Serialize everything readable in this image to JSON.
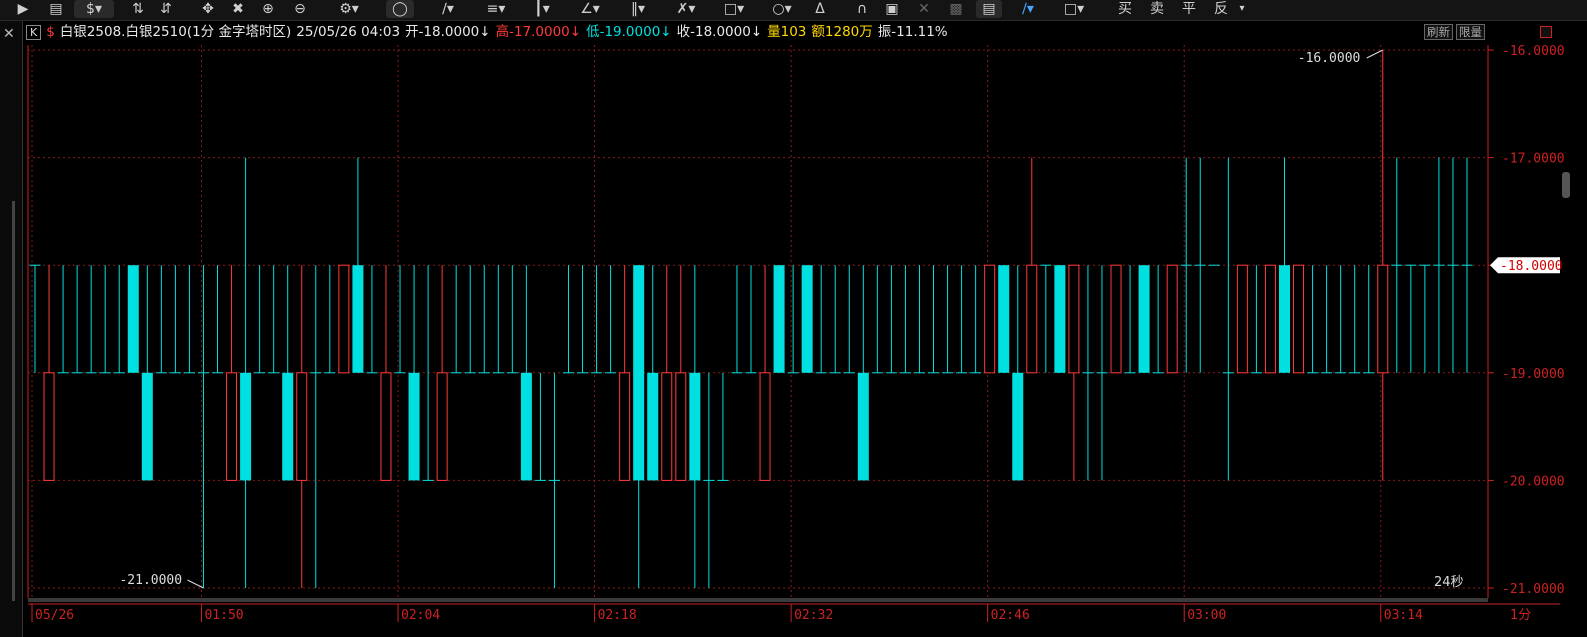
{
  "toolbar": {
    "trade_labels": [
      "买",
      "卖",
      "平",
      "反"
    ]
  },
  "info": {
    "k_label": "K",
    "dollar": "$",
    "title": "白银2508.白银2510(1分 金字塔时区)",
    "datetime": "25/05/26 04:03",
    "open": "开-18.0000",
    "high": "高-17.0000",
    "low": "低-19.0000",
    "close": "收-18.0000",
    "volume": "量103",
    "amount": "额1280万",
    "amplitude": "振-11.11%",
    "refresh": "刷新",
    "limit": "限量"
  },
  "colors": {
    "up": "#ff3b3b",
    "down": "#00e0e0",
    "grid": "#8a1a1a",
    "axis": "#cc2222",
    "text": "#dddddd",
    "yellow": "#ffd800"
  },
  "chart_data": {
    "type": "candlestick",
    "y_ticks": [
      "-16.0000",
      "-17.0000",
      "-18.0000",
      "-19.0000",
      "-20.0000",
      "-21.0000"
    ],
    "y_range": [
      -21,
      -16
    ],
    "current_price": "-18.0000",
    "x_ticks": [
      "05/26",
      "01:50",
      "02:04",
      "02:18",
      "02:32",
      "02:46",
      "03:00",
      "03:14"
    ],
    "period": "1分",
    "countdown": "24秒",
    "max_label": "-16.0000",
    "min_label": "-21.0000",
    "candles": [
      {
        "o": -18,
        "c": -18,
        "h": -18,
        "l": -19
      },
      {
        "o": -20,
        "c": -19,
        "h": -18,
        "l": -20
      },
      {
        "o": -19,
        "c": -19,
        "h": -18,
        "l": -19
      },
      {
        "o": -19,
        "c": -19,
        "h": -18,
        "l": -19
      },
      {
        "o": -19,
        "c": -19,
        "h": -18,
        "l": -19
      },
      {
        "o": -19,
        "c": -19,
        "h": -18,
        "l": -19
      },
      {
        "o": -19,
        "c": -19,
        "h": -18,
        "l": -19
      },
      {
        "o": -18,
        "c": -19,
        "h": -18,
        "l": -19
      },
      {
        "o": -19,
        "c": -20,
        "h": -18,
        "l": -20
      },
      {
        "o": -19,
        "c": -19,
        "h": -18,
        "l": -19
      },
      {
        "o": -19,
        "c": -19,
        "h": -18,
        "l": -19
      },
      {
        "o": -19,
        "c": -19,
        "h": -18,
        "l": -19
      },
      {
        "o": -19,
        "c": -19,
        "h": -18,
        "l": -21
      },
      {
        "o": -19,
        "c": -19,
        "h": -18,
        "l": -19
      },
      {
        "o": -20,
        "c": -19,
        "h": -18,
        "l": -20
      },
      {
        "o": -19,
        "c": -20,
        "h": -17,
        "l": -21
      },
      {
        "o": -19,
        "c": -19,
        "h": -18,
        "l": -19
      },
      {
        "o": -19,
        "c": -19,
        "h": -18,
        "l": -19
      },
      {
        "o": -19,
        "c": -20,
        "h": -18,
        "l": -20
      },
      {
        "o": -20,
        "c": -19,
        "h": -18,
        "l": -21
      },
      {
        "o": -19,
        "c": -19,
        "h": -18,
        "l": -21
      },
      {
        "o": -19,
        "c": -19,
        "h": -18,
        "l": -19
      },
      {
        "o": -19,
        "c": -18,
        "h": -18,
        "l": -19
      },
      {
        "o": -18,
        "c": -19,
        "h": -17,
        "l": -19
      },
      {
        "o": -19,
        "c": -19,
        "h": -18,
        "l": -19
      },
      {
        "o": -20,
        "c": -19,
        "h": -18,
        "l": -20
      },
      {
        "o": -19,
        "c": -19,
        "h": -18,
        "l": -19
      },
      {
        "o": -19,
        "c": -20,
        "h": -18,
        "l": -20
      },
      {
        "o": -20,
        "c": -20,
        "h": -18,
        "l": -20
      },
      {
        "o": -20,
        "c": -19,
        "h": -18,
        "l": -20
      },
      {
        "o": -19,
        "c": -19,
        "h": -18,
        "l": -19
      },
      {
        "o": -19,
        "c": -19,
        "h": -18,
        "l": -19
      },
      {
        "o": -19,
        "c": -19,
        "h": -18,
        "l": -19
      },
      {
        "o": -19,
        "c": -19,
        "h": -18,
        "l": -19
      },
      {
        "o": -19,
        "c": -19,
        "h": -18,
        "l": -19
      },
      {
        "o": -19,
        "c": -20,
        "h": -18,
        "l": -20
      },
      {
        "o": -20,
        "c": -20,
        "h": -19,
        "l": -20
      },
      {
        "o": -20,
        "c": -20,
        "h": -19,
        "l": -21
      },
      {
        "o": -19,
        "c": -19,
        "h": -18,
        "l": -19
      },
      {
        "o": -19,
        "c": -19,
        "h": -18,
        "l": -19
      },
      {
        "o": -19,
        "c": -19,
        "h": -18,
        "l": -19
      },
      {
        "o": -19,
        "c": -19,
        "h": -18,
        "l": -19
      },
      {
        "o": -20,
        "c": -19,
        "h": -18,
        "l": -20
      },
      {
        "o": -18,
        "c": -20,
        "h": -18,
        "l": -21
      },
      {
        "o": -19,
        "c": -20,
        "h": -18,
        "l": -20
      },
      {
        "o": -20,
        "c": -19,
        "h": -18,
        "l": -20
      },
      {
        "o": -20,
        "c": -19,
        "h": -18,
        "l": -20
      },
      {
        "o": -19,
        "c": -20,
        "h": -18,
        "l": -21
      },
      {
        "o": -20,
        "c": -20,
        "h": -19,
        "l": -21
      },
      {
        "o": -20,
        "c": -20,
        "h": -19,
        "l": -20
      },
      {
        "o": -19,
        "c": -19,
        "h": -18,
        "l": -19
      },
      {
        "o": -19,
        "c": -19,
        "h": -18,
        "l": -19
      },
      {
        "o": -20,
        "c": -19,
        "h": -18,
        "l": -20
      },
      {
        "o": -18,
        "c": -19,
        "h": -18,
        "l": -19
      },
      {
        "o": -19,
        "c": -19,
        "h": -18,
        "l": -19
      },
      {
        "o": -18,
        "c": -19,
        "h": -18,
        "l": -19
      },
      {
        "o": -19,
        "c": -19,
        "h": -18,
        "l": -19
      },
      {
        "o": -19,
        "c": -19,
        "h": -18,
        "l": -19
      },
      {
        "o": -19,
        "c": -19,
        "h": -18,
        "l": -19
      },
      {
        "o": -19,
        "c": -20,
        "h": -18,
        "l": -20
      },
      {
        "o": -19,
        "c": -19,
        "h": -18,
        "l": -19
      },
      {
        "o": -19,
        "c": -19,
        "h": -18,
        "l": -19
      },
      {
        "o": -19,
        "c": -19,
        "h": -18,
        "l": -19
      },
      {
        "o": -19,
        "c": -19,
        "h": -18,
        "l": -19
      },
      {
        "o": -19,
        "c": -19,
        "h": -18,
        "l": -19
      },
      {
        "o": -19,
        "c": -19,
        "h": -18,
        "l": -19
      },
      {
        "o": -19,
        "c": -19,
        "h": -18,
        "l": -19
      },
      {
        "o": -19,
        "c": -19,
        "h": -18,
        "l": -19
      },
      {
        "o": -19,
        "c": -18,
        "h": -18,
        "l": -19
      },
      {
        "o": -18,
        "c": -19,
        "h": -18,
        "l": -19
      },
      {
        "o": -19,
        "c": -20,
        "h": -18,
        "l": -20
      },
      {
        "o": -19,
        "c": -18,
        "h": -17,
        "l": -19
      },
      {
        "o": -18,
        "c": -18,
        "h": -18,
        "l": -19
      },
      {
        "o": -18,
        "c": -19,
        "h": -18,
        "l": -19
      },
      {
        "o": -19,
        "c": -18,
        "h": -18,
        "l": -20
      },
      {
        "o": -19,
        "c": -19,
        "h": -18,
        "l": -20
      },
      {
        "o": -19,
        "c": -19,
        "h": -18,
        "l": -20
      },
      {
        "o": -19,
        "c": -18,
        "h": -18,
        "l": -19
      },
      {
        "o": -19,
        "c": -19,
        "h": -18,
        "l": -19
      },
      {
        "o": -18,
        "c": -19,
        "h": -18,
        "l": -19
      },
      {
        "o": -19,
        "c": -19,
        "h": -18,
        "l": -19
      },
      {
        "o": -19,
        "c": -18,
        "h": -18,
        "l": -19
      },
      {
        "o": -18,
        "c": -18,
        "h": -17,
        "l": -19
      },
      {
        "o": -18,
        "c": -18,
        "h": -17,
        "l": -19
      },
      {
        "o": -18,
        "c": -18,
        "h": -18,
        "l": -18
      },
      {
        "o": -19,
        "c": -19,
        "h": -17,
        "l": -20
      },
      {
        "o": -19,
        "c": -18,
        "h": -18,
        "l": -19
      },
      {
        "o": -19,
        "c": -19,
        "h": -18,
        "l": -19
      },
      {
        "o": -19,
        "c": -18,
        "h": -18,
        "l": -19
      },
      {
        "o": -18,
        "c": -19,
        "h": -17,
        "l": -19
      },
      {
        "o": -19,
        "c": -18,
        "h": -18,
        "l": -19
      },
      {
        "o": -19,
        "c": -19,
        "h": -18,
        "l": -19
      },
      {
        "o": -19,
        "c": -19,
        "h": -18,
        "l": -19
      },
      {
        "o": -19,
        "c": -19,
        "h": -18,
        "l": -19
      },
      {
        "o": -19,
        "c": -19,
        "h": -18,
        "l": -19
      },
      {
        "o": -19,
        "c": -19,
        "h": -18,
        "l": -19
      },
      {
        "o": -19,
        "c": -18,
        "h": -16,
        "l": -20
      },
      {
        "o": -18,
        "c": -18,
        "h": -17,
        "l": -19
      },
      {
        "o": -18,
        "c": -18,
        "h": -18,
        "l": -19
      },
      {
        "o": -18,
        "c": -18,
        "h": -18,
        "l": -19
      },
      {
        "o": -18,
        "c": -18,
        "h": -17,
        "l": -19
      },
      {
        "o": -18,
        "c": -18,
        "h": -17,
        "l": -19
      },
      {
        "o": -18,
        "c": -18,
        "h": -17,
        "l": -19
      }
    ]
  }
}
